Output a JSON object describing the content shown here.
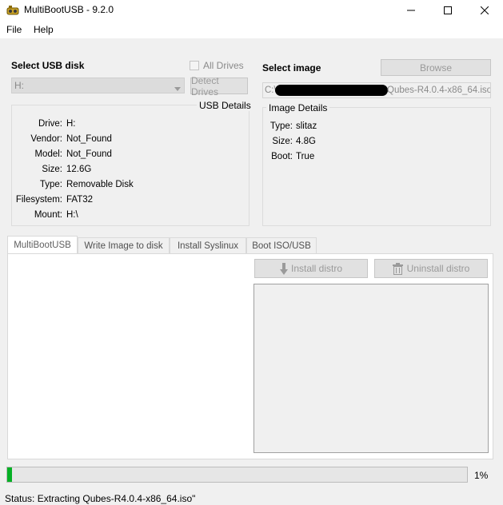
{
  "window": {
    "title": "MultiBootUSB - 9.2.0",
    "minimize_glyph": "—",
    "maximize_glyph": "☐",
    "close_glyph": "✕"
  },
  "menu": [
    "File",
    "Help"
  ],
  "usb": {
    "section_title": "Select USB disk",
    "all_drives_label": "All Drives",
    "selected_drive": "H:",
    "detect_button": "Detect Drives",
    "details_title": "USB Details",
    "details": [
      {
        "key": "Drive:",
        "value": "H:"
      },
      {
        "key": "Vendor:",
        "value": "Not_Found"
      },
      {
        "key": "Model:",
        "value": "Not_Found"
      },
      {
        "key": "Size:",
        "value": "12.6G"
      },
      {
        "key": "Type:",
        "value": "Removable Disk"
      },
      {
        "key": "Filesystem:",
        "value": "FAT32"
      },
      {
        "key": "Mount:",
        "value": "H:\\"
      }
    ]
  },
  "image": {
    "section_title": "Select image",
    "browse_button": "Browse",
    "path_prefix": "C:\\",
    "path_suffix": "Qubes-R4.0.4-x86_64.iso",
    "details_title": "Image Details",
    "details": [
      {
        "key": "Type:",
        "value": "slitaz"
      },
      {
        "key": "Size:",
        "value": "4.8G"
      },
      {
        "key": "Boot:",
        "value": "True"
      }
    ]
  },
  "tabs": [
    "MultiBootUSB",
    "Write Image to disk",
    "Install Syslinux",
    "Boot ISO/USB"
  ],
  "actions": {
    "install_label": "Install distro",
    "uninstall_label": "Uninstall distro"
  },
  "progress": {
    "fraction": 0.01,
    "label": "1%",
    "accent": "#06b025"
  },
  "status_text": "Status: Extracting Qubes-R4.0.4-x86_64.iso\""
}
